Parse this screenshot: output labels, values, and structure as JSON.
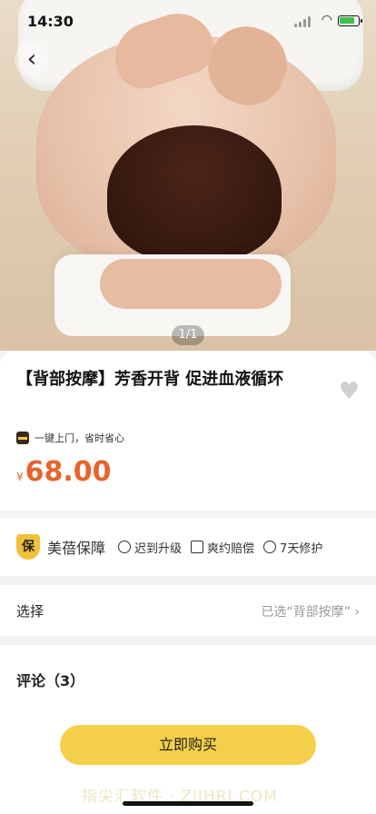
{
  "status_bar": {
    "time": "14:30"
  },
  "hero": {
    "pager": "1/1"
  },
  "product": {
    "title": "【背部按摩】芳香开背 促进血液循环",
    "tag": "一键上门，省时省心",
    "currency": "¥",
    "price": "68.00"
  },
  "guarantee": {
    "badge": "保",
    "title": "美蓓保障",
    "items": [
      {
        "label": "迟到升级",
        "icon": "clock-icon"
      },
      {
        "label": "爽约赔偿",
        "icon": "document-icon"
      },
      {
        "label": "7天修护",
        "icon": "repair-icon"
      }
    ]
  },
  "choose": {
    "label": "选择",
    "selected": "已选“背部按摩”"
  },
  "comments": {
    "label": "评论（3）"
  },
  "bottom": {
    "buy_label": "立即购买",
    "watermark": "指尖汇软件 · ZIJHRJ.COM"
  },
  "colors": {
    "accent": "#f4cf4a",
    "price": "#e8632b"
  }
}
